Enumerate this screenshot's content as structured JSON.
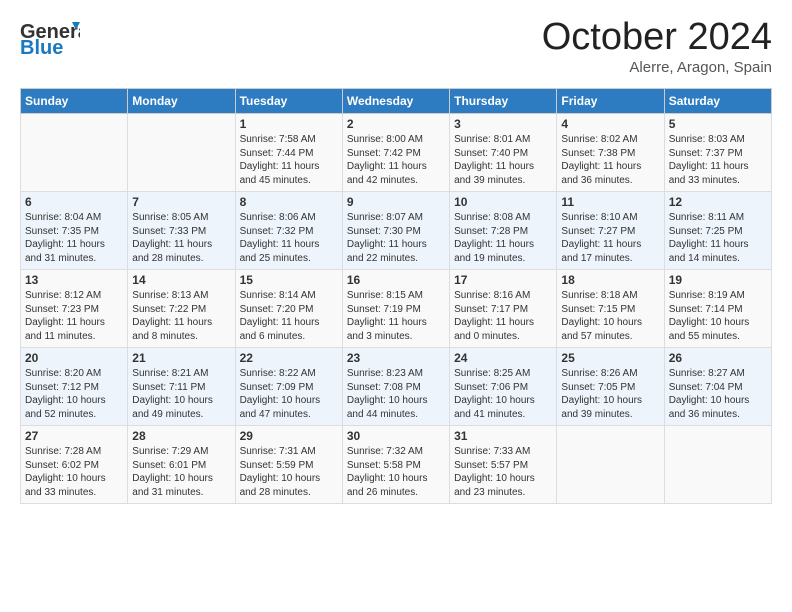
{
  "header": {
    "logo_general": "General",
    "logo_blue": "Blue",
    "month": "October 2024",
    "location": "Alerre, Aragon, Spain"
  },
  "weekdays": [
    "Sunday",
    "Monday",
    "Tuesday",
    "Wednesday",
    "Thursday",
    "Friday",
    "Saturday"
  ],
  "weeks": [
    [
      {
        "day": "",
        "sunrise": "",
        "sunset": "",
        "daylight": ""
      },
      {
        "day": "",
        "sunrise": "",
        "sunset": "",
        "daylight": ""
      },
      {
        "day": "1",
        "sunrise": "Sunrise: 7:58 AM",
        "sunset": "Sunset: 7:44 PM",
        "daylight": "Daylight: 11 hours and 45 minutes."
      },
      {
        "day": "2",
        "sunrise": "Sunrise: 8:00 AM",
        "sunset": "Sunset: 7:42 PM",
        "daylight": "Daylight: 11 hours and 42 minutes."
      },
      {
        "day": "3",
        "sunrise": "Sunrise: 8:01 AM",
        "sunset": "Sunset: 7:40 PM",
        "daylight": "Daylight: 11 hours and 39 minutes."
      },
      {
        "day": "4",
        "sunrise": "Sunrise: 8:02 AM",
        "sunset": "Sunset: 7:38 PM",
        "daylight": "Daylight: 11 hours and 36 minutes."
      },
      {
        "day": "5",
        "sunrise": "Sunrise: 8:03 AM",
        "sunset": "Sunset: 7:37 PM",
        "daylight": "Daylight: 11 hours and 33 minutes."
      }
    ],
    [
      {
        "day": "6",
        "sunrise": "Sunrise: 8:04 AM",
        "sunset": "Sunset: 7:35 PM",
        "daylight": "Daylight: 11 hours and 31 minutes."
      },
      {
        "day": "7",
        "sunrise": "Sunrise: 8:05 AM",
        "sunset": "Sunset: 7:33 PM",
        "daylight": "Daylight: 11 hours and 28 minutes."
      },
      {
        "day": "8",
        "sunrise": "Sunrise: 8:06 AM",
        "sunset": "Sunset: 7:32 PM",
        "daylight": "Daylight: 11 hours and 25 minutes."
      },
      {
        "day": "9",
        "sunrise": "Sunrise: 8:07 AM",
        "sunset": "Sunset: 7:30 PM",
        "daylight": "Daylight: 11 hours and 22 minutes."
      },
      {
        "day": "10",
        "sunrise": "Sunrise: 8:08 AM",
        "sunset": "Sunset: 7:28 PM",
        "daylight": "Daylight: 11 hours and 19 minutes."
      },
      {
        "day": "11",
        "sunrise": "Sunrise: 8:10 AM",
        "sunset": "Sunset: 7:27 PM",
        "daylight": "Daylight: 11 hours and 17 minutes."
      },
      {
        "day": "12",
        "sunrise": "Sunrise: 8:11 AM",
        "sunset": "Sunset: 7:25 PM",
        "daylight": "Daylight: 11 hours and 14 minutes."
      }
    ],
    [
      {
        "day": "13",
        "sunrise": "Sunrise: 8:12 AM",
        "sunset": "Sunset: 7:23 PM",
        "daylight": "Daylight: 11 hours and 11 minutes."
      },
      {
        "day": "14",
        "sunrise": "Sunrise: 8:13 AM",
        "sunset": "Sunset: 7:22 PM",
        "daylight": "Daylight: 11 hours and 8 minutes."
      },
      {
        "day": "15",
        "sunrise": "Sunrise: 8:14 AM",
        "sunset": "Sunset: 7:20 PM",
        "daylight": "Daylight: 11 hours and 6 minutes."
      },
      {
        "day": "16",
        "sunrise": "Sunrise: 8:15 AM",
        "sunset": "Sunset: 7:19 PM",
        "daylight": "Daylight: 11 hours and 3 minutes."
      },
      {
        "day": "17",
        "sunrise": "Sunrise: 8:16 AM",
        "sunset": "Sunset: 7:17 PM",
        "daylight": "Daylight: 11 hours and 0 minutes."
      },
      {
        "day": "18",
        "sunrise": "Sunrise: 8:18 AM",
        "sunset": "Sunset: 7:15 PM",
        "daylight": "Daylight: 10 hours and 57 minutes."
      },
      {
        "day": "19",
        "sunrise": "Sunrise: 8:19 AM",
        "sunset": "Sunset: 7:14 PM",
        "daylight": "Daylight: 10 hours and 55 minutes."
      }
    ],
    [
      {
        "day": "20",
        "sunrise": "Sunrise: 8:20 AM",
        "sunset": "Sunset: 7:12 PM",
        "daylight": "Daylight: 10 hours and 52 minutes."
      },
      {
        "day": "21",
        "sunrise": "Sunrise: 8:21 AM",
        "sunset": "Sunset: 7:11 PM",
        "daylight": "Daylight: 10 hours and 49 minutes."
      },
      {
        "day": "22",
        "sunrise": "Sunrise: 8:22 AM",
        "sunset": "Sunset: 7:09 PM",
        "daylight": "Daylight: 10 hours and 47 minutes."
      },
      {
        "day": "23",
        "sunrise": "Sunrise: 8:23 AM",
        "sunset": "Sunset: 7:08 PM",
        "daylight": "Daylight: 10 hours and 44 minutes."
      },
      {
        "day": "24",
        "sunrise": "Sunrise: 8:25 AM",
        "sunset": "Sunset: 7:06 PM",
        "daylight": "Daylight: 10 hours and 41 minutes."
      },
      {
        "day": "25",
        "sunrise": "Sunrise: 8:26 AM",
        "sunset": "Sunset: 7:05 PM",
        "daylight": "Daylight: 10 hours and 39 minutes."
      },
      {
        "day": "26",
        "sunrise": "Sunrise: 8:27 AM",
        "sunset": "Sunset: 7:04 PM",
        "daylight": "Daylight: 10 hours and 36 minutes."
      }
    ],
    [
      {
        "day": "27",
        "sunrise": "Sunrise: 7:28 AM",
        "sunset": "Sunset: 6:02 PM",
        "daylight": "Daylight: 10 hours and 33 minutes."
      },
      {
        "day": "28",
        "sunrise": "Sunrise: 7:29 AM",
        "sunset": "Sunset: 6:01 PM",
        "daylight": "Daylight: 10 hours and 31 minutes."
      },
      {
        "day": "29",
        "sunrise": "Sunrise: 7:31 AM",
        "sunset": "Sunset: 5:59 PM",
        "daylight": "Daylight: 10 hours and 28 minutes."
      },
      {
        "day": "30",
        "sunrise": "Sunrise: 7:32 AM",
        "sunset": "Sunset: 5:58 PM",
        "daylight": "Daylight: 10 hours and 26 minutes."
      },
      {
        "day": "31",
        "sunrise": "Sunrise: 7:33 AM",
        "sunset": "Sunset: 5:57 PM",
        "daylight": "Daylight: 10 hours and 23 minutes."
      },
      {
        "day": "",
        "sunrise": "",
        "sunset": "",
        "daylight": ""
      },
      {
        "day": "",
        "sunrise": "",
        "sunset": "",
        "daylight": ""
      }
    ]
  ]
}
